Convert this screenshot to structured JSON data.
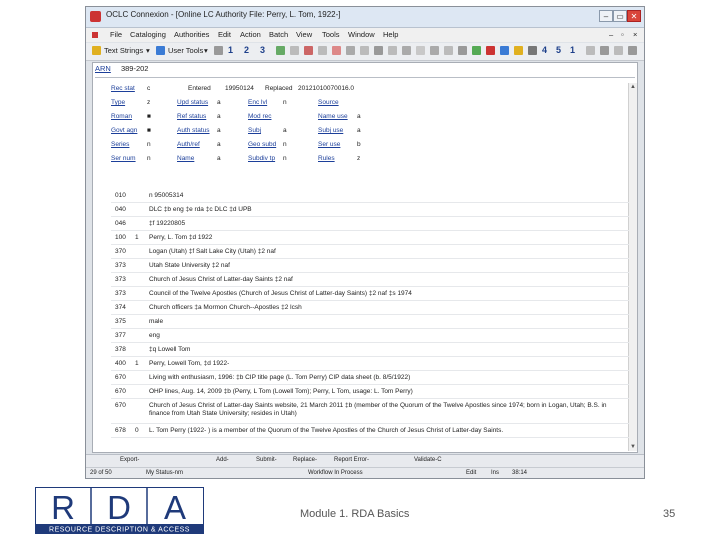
{
  "window": {
    "title": "OCLC Connexion - [Online LC Authority File: Perry, L. Tom, 1922-]",
    "controls": [
      "–",
      "▭",
      "✕"
    ]
  },
  "menu": [
    "File",
    "Cataloging",
    "Authorities",
    "Edit",
    "Action",
    "Batch",
    "View",
    "Tools",
    "Window",
    "Help"
  ],
  "toolbar": {
    "text_strings_label": "Text Strings",
    "user_tools_label": "User Tools",
    "numbers": [
      "1",
      "2",
      "3",
      "4",
      "5",
      "1"
    ]
  },
  "record": {
    "arn_label": "ARN",
    "arn_value": "389-202",
    "entered_label": "Entered",
    "entered_value": "19950124",
    "replaced_label": "Replaced",
    "replaced_value": "20121010070016.0",
    "fixed_fields": [
      [
        {
          "label": "Rec stat",
          "value": "c"
        },
        {
          "label": "Upd status",
          "value": "a"
        },
        {
          "label": "Enc lvl",
          "value": "n"
        },
        {
          "label": "Source",
          "value": ""
        }
      ],
      [
        {
          "label": "Type",
          "value": "z"
        },
        {
          "label": "Ref status",
          "value": "a"
        },
        {
          "label": "Mod rec",
          "value": ""
        },
        {
          "label": "Name use",
          "value": "a"
        }
      ],
      [
        {
          "label": "Roman",
          "value": "■"
        },
        {
          "label": "Auth status",
          "value": "a"
        },
        {
          "label": "Subj",
          "value": "a"
        },
        {
          "label": "Subj use",
          "value": "a"
        }
      ],
      [
        {
          "label": "Govt agn",
          "value": "■"
        },
        {
          "label": "Auth/ref",
          "value": "a"
        },
        {
          "label": "Geo subd",
          "value": "n"
        },
        {
          "label": "Ser use",
          "value": "b"
        }
      ],
      [
        {
          "label": "Series",
          "value": "n"
        },
        {
          "label": "Name",
          "value": "a"
        },
        {
          "label": "Subdiv tp",
          "value": "n"
        },
        {
          "label": "Rules",
          "value": "z"
        }
      ],
      [
        {
          "label": "Ser num",
          "value": "n"
        },
        {
          "label": "",
          "value": ""
        },
        {
          "label": "",
          "value": ""
        },
        {
          "label": "",
          "value": ""
        }
      ]
    ],
    "fields": [
      {
        "tag": "010",
        "ind": "",
        "text": "n 95005314"
      },
      {
        "tag": "040",
        "ind": "",
        "text": "DLC ‡b eng ‡e rda ‡c DLC ‡d UPB"
      },
      {
        "tag": "046",
        "ind": "",
        "text": "‡f 19220805"
      },
      {
        "tag": "100",
        "ind": "1",
        "text": "Perry, L. Tom ‡d 1922"
      },
      {
        "tag": "370",
        "ind": "",
        "text": "Logan (Utah) ‡f Salt Lake City (Utah) ‡2 naf"
      },
      {
        "tag": "373",
        "ind": "",
        "text": "Utah State University ‡2 naf"
      },
      {
        "tag": "373",
        "ind": "",
        "text": "Church of Jesus Christ of Latter-day Saints ‡2 naf"
      },
      {
        "tag": "373",
        "ind": "",
        "text": "Council of the Twelve Apostles (Church of Jesus Christ of Latter-day Saints) ‡2 naf ‡s 1974"
      },
      {
        "tag": "374",
        "ind": "",
        "text": "Church officers ‡a Mormon Church--Apostles ‡2 lcsh"
      },
      {
        "tag": "375",
        "ind": "",
        "text": "male"
      },
      {
        "tag": "377",
        "ind": "",
        "text": "eng"
      },
      {
        "tag": "378",
        "ind": "",
        "text": "‡q Lowell Tom"
      },
      {
        "tag": "400",
        "ind": "1",
        "text": "Perry, Lowell Tom, ‡d 1922-"
      },
      {
        "tag": "670",
        "ind": "",
        "text": "Living with enthusiasm, 1996: ‡b CIP title page (L. Tom Perry) CIP data sheet (b. 8/5/1922)"
      },
      {
        "tag": "670",
        "ind": "",
        "text": "OHP lines, Aug. 14, 2009 ‡b (Perry, L Tom (Lowell Tom); Perry, L Tom, usage: L. Tom Perry)"
      },
      {
        "tag": "670",
        "ind": "",
        "text": "Church of Jesus Christ of Latter-day Saints website, 21 March 2011 ‡b (member of the Quorum of the Twelve Apostles since 1974; born in Logan, Utah; B.S. in finance from Utah State University; resides in Utah)",
        "tall": true
      },
      {
        "tag": "678",
        "ind": "0",
        "text": "L. Tom Perry (1922- ) is a member of the Quorum of the Twelve Apostles of the Church of Jesus Christ of Latter-day Saints."
      }
    ]
  },
  "status": {
    "row1": [
      "Export-",
      "Add-",
      "Submit-",
      "Replace-",
      "Report Error-",
      "Validate-C"
    ],
    "record_count": "29 of 50",
    "status_name": "My Status-nm",
    "workflow": "Workflow In Process",
    "mode": "Edit",
    "mode2": "Ins",
    "col": "38:14"
  },
  "logo": {
    "letters": [
      "R",
      "D",
      "A"
    ],
    "tagline": "RESOURCE DESCRIPTION & ACCESS",
    "color": "#1f3a7a"
  },
  "footer": {
    "text": "Module 1. RDA Basics",
    "page": "35"
  }
}
